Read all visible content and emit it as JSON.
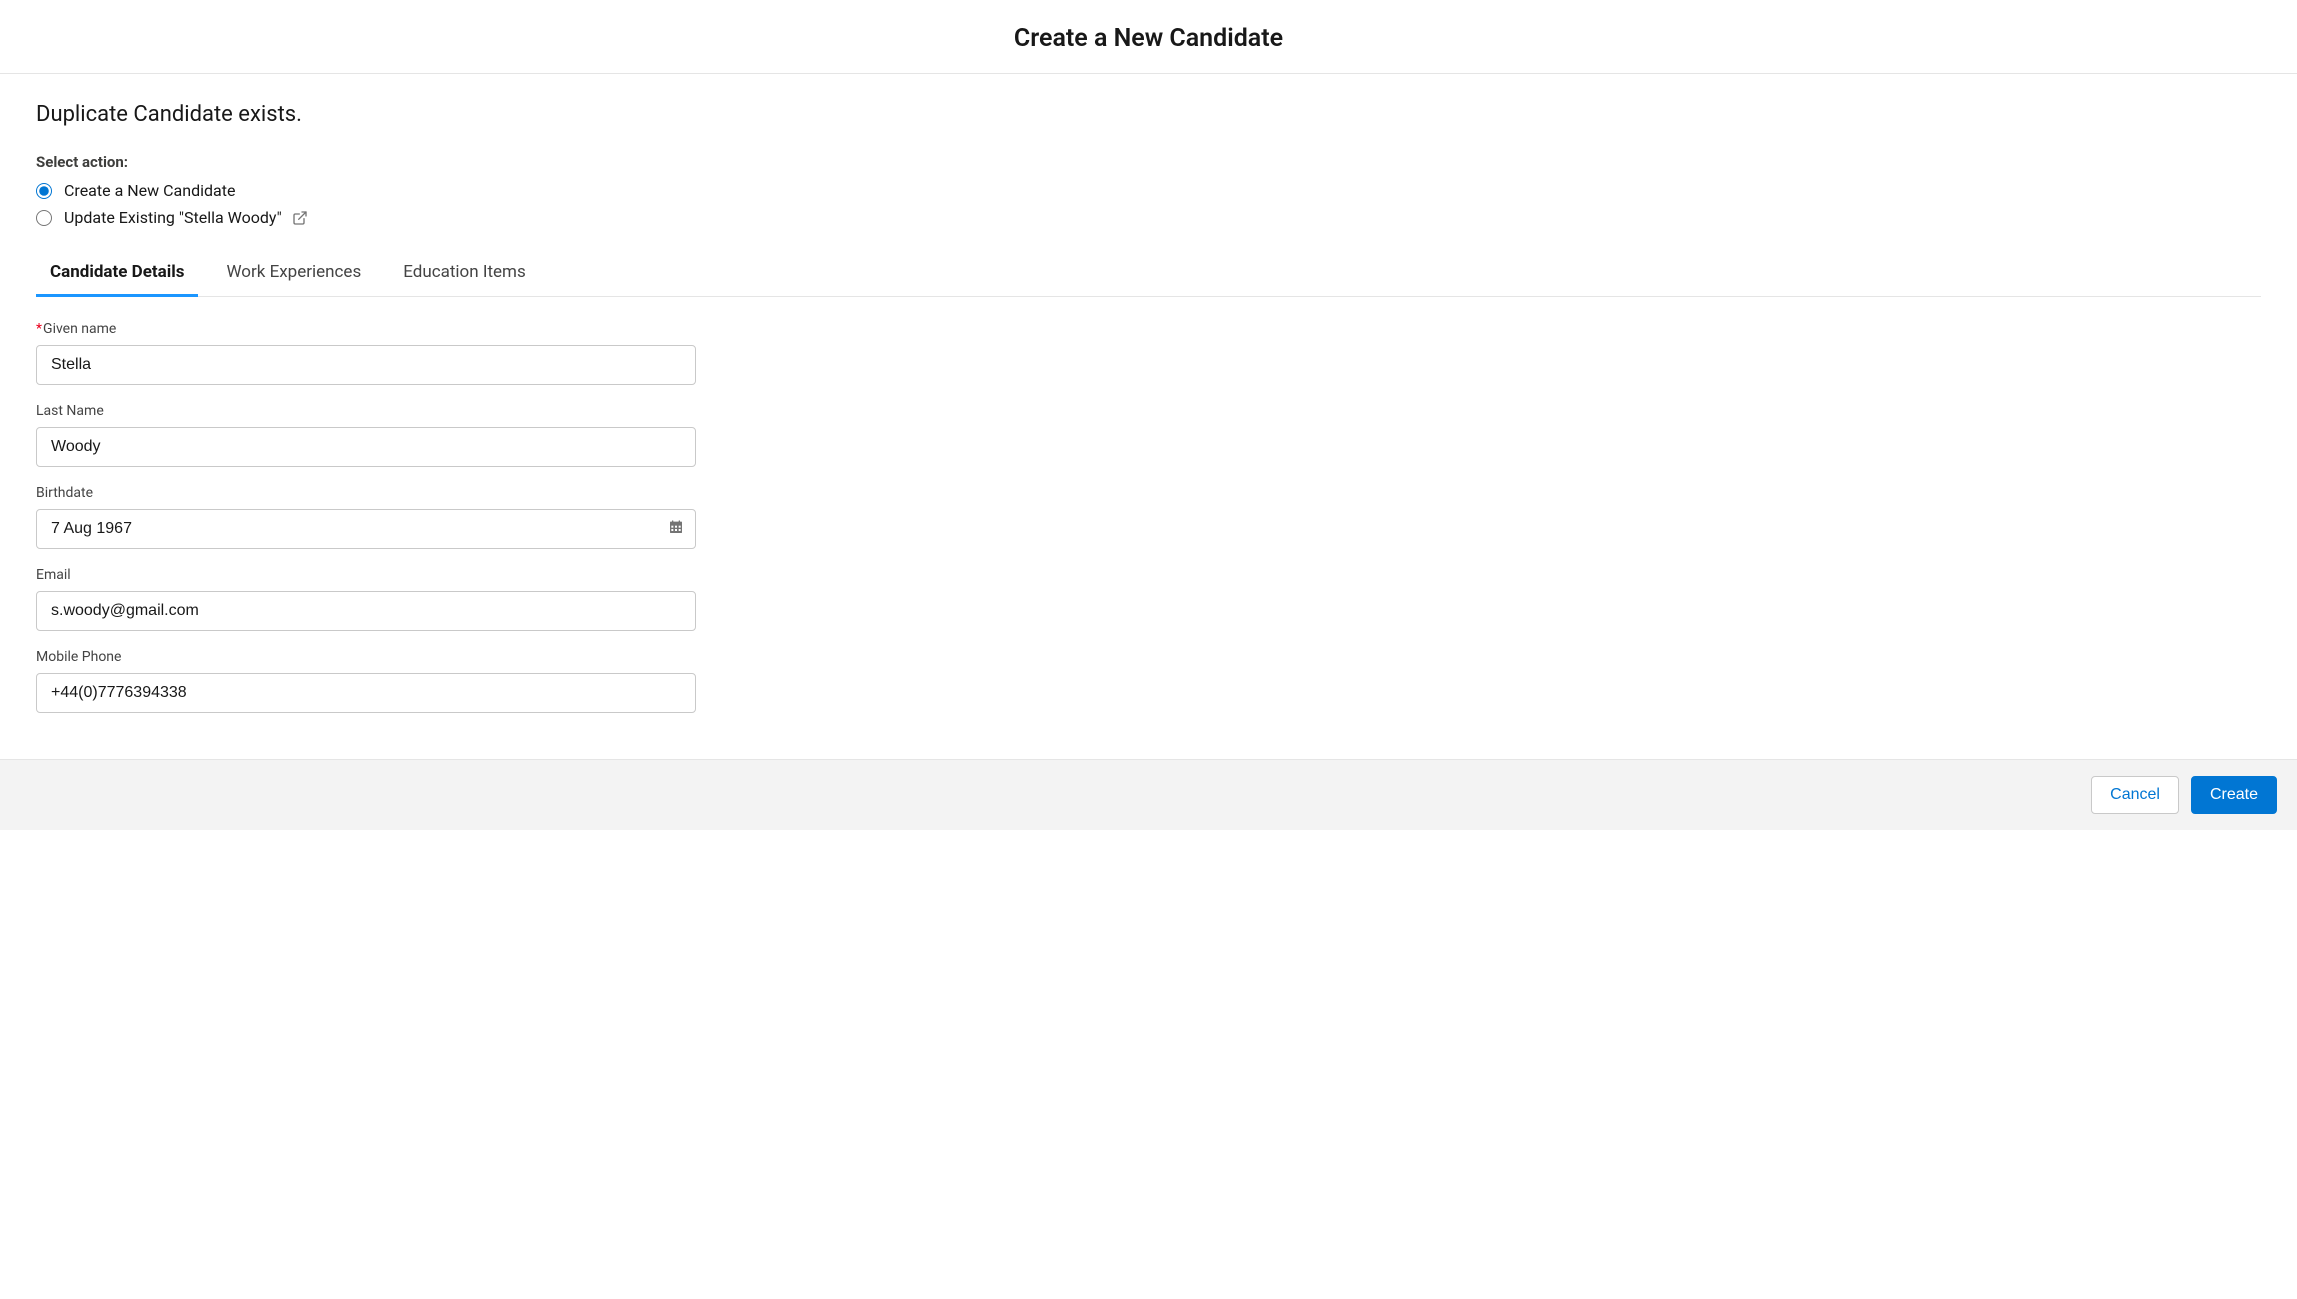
{
  "header": {
    "title": "Create a New Candidate"
  },
  "duplicate": {
    "message": "Duplicate Candidate exists.",
    "select_action_label": "Select action:",
    "options": {
      "create_new": "Create a New Candidate",
      "update_existing": "Update Existing \"Stella Woody\""
    }
  },
  "tabs": [
    {
      "label": "Candidate Details",
      "active": true
    },
    {
      "label": "Work Experiences",
      "active": false
    },
    {
      "label": "Education Items",
      "active": false
    }
  ],
  "form": {
    "given_name": {
      "label": "Given name",
      "value": "Stella",
      "required": true
    },
    "last_name": {
      "label": "Last Name",
      "value": "Woody"
    },
    "birthdate": {
      "label": "Birthdate",
      "value": "7 Aug 1967"
    },
    "email": {
      "label": "Email",
      "value": "s.woody@gmail.com"
    },
    "mobile_phone": {
      "label": "Mobile Phone",
      "value": "+44(0)7776394338"
    }
  },
  "footer": {
    "cancel_label": "Cancel",
    "create_label": "Create"
  }
}
